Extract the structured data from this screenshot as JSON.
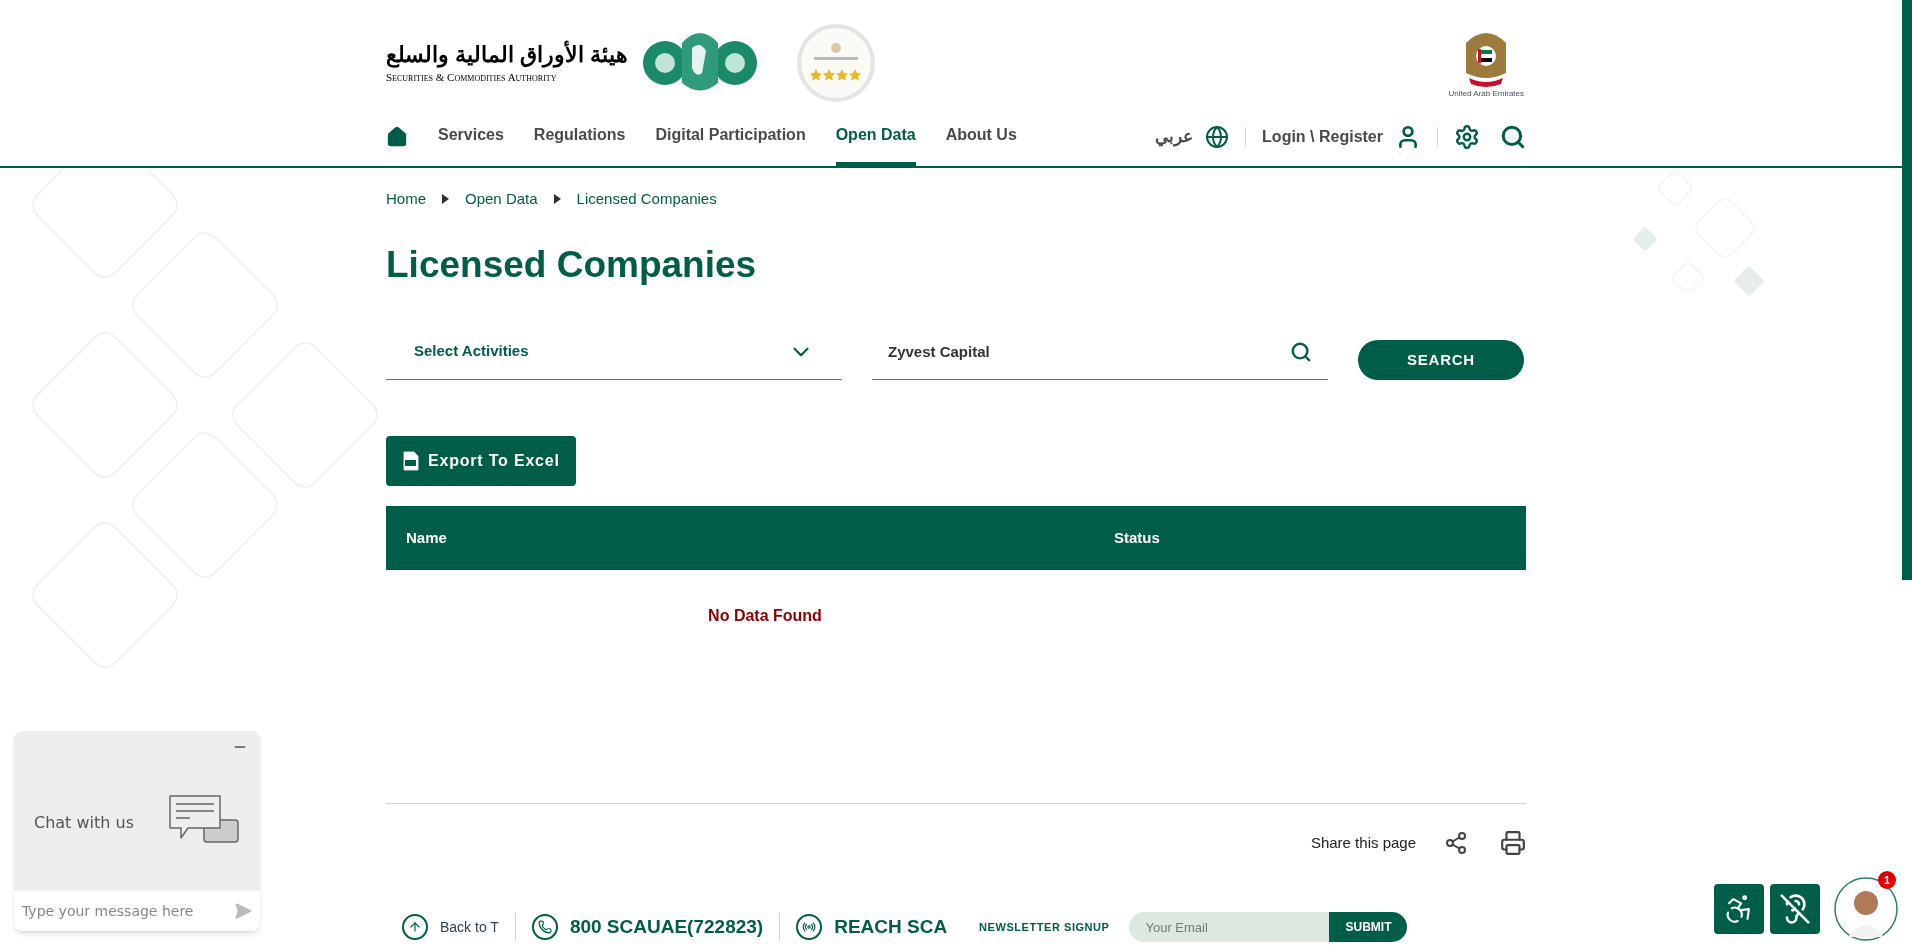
{
  "header": {
    "logo_arabic": "هيئة الأوراق المالية والسلع",
    "logo_english": "Securities & Commodities Authority",
    "emblem_caption": "United Arab Emirates"
  },
  "nav": [
    {
      "label": "Services",
      "selected": false
    },
    {
      "label": "Regulations",
      "selected": false
    },
    {
      "label": "Digital Participation",
      "selected": false
    },
    {
      "label": "Open Data",
      "selected": true
    },
    {
      "label": "About Us",
      "selected": false
    }
  ],
  "language": "عربي",
  "login": "Login \\ Register",
  "breadcrumb": [
    "Home",
    "Open Data",
    "Licensed Companies"
  ],
  "title": "Licensed Companies",
  "filters": {
    "activity_select": "Select Activities",
    "search_value": "Zyvest Capital",
    "search_button": "SEARCH"
  },
  "export_button": "Export To Excel",
  "table": {
    "columns": [
      "Name",
      "Status"
    ],
    "empty_message": "No Data Found"
  },
  "share_label": "Share this page",
  "chat": {
    "title": "Chat with us",
    "placeholder": "Type your message here"
  },
  "assistant_badge": "1",
  "footer": [
    {
      "kind": "link",
      "label": "Back to T"
    },
    {
      "kind": "phone",
      "label": "800 SCAUAE(722823)"
    },
    {
      "kind": "reach",
      "label": "REACH SCA"
    },
    {
      "kind": "newsletter",
      "label": "NEWSLETTER SIGNUP",
      "placeholder": "Your Email",
      "button": "SUBMIT"
    }
  ]
}
